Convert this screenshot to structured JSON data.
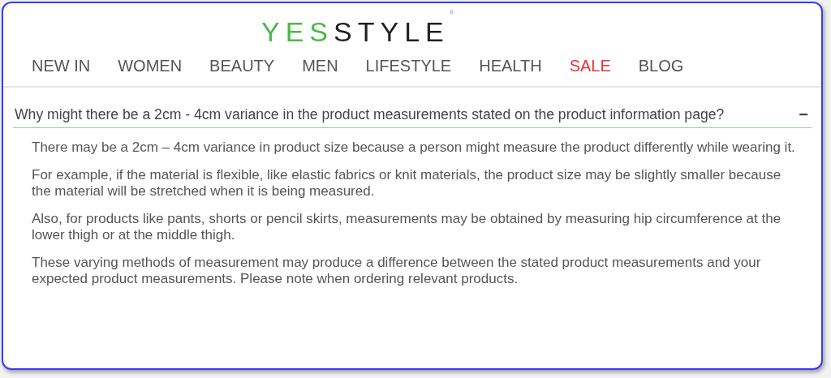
{
  "logo": {
    "parts": [
      {
        "text": "YES",
        "color": "#4cb748"
      },
      {
        "text": "STYLE",
        "color": "#231f20"
      }
    ],
    "mark": "®"
  },
  "nav": [
    {
      "label": "NEW IN",
      "highlighted": false
    },
    {
      "label": "WOMEN",
      "highlighted": false
    },
    {
      "label": "BEAUTY",
      "highlighted": false
    },
    {
      "label": "MEN",
      "highlighted": false
    },
    {
      "label": "LIFESTYLE",
      "highlighted": false
    },
    {
      "label": "HEALTH",
      "highlighted": false
    },
    {
      "label": "SALE",
      "highlighted": true
    },
    {
      "label": "BLOG",
      "highlighted": false
    }
  ],
  "faq": {
    "question": "Why might there be a 2cm - 4cm variance in the product measurements stated on the product information page?",
    "toggle": "−",
    "expanded": true,
    "answer": [
      "There may be a 2cm – 4cm variance in product size because a person might measure the product differently while wearing it.",
      "For example, if the material is flexible, like elastic fabrics or knit materials, the product size may be slightly smaller because the material will be stretched when it is being measured.",
      "Also, for products like pants, shorts or pencil skirts, measurements may be obtained by measuring hip circumference at the lower thigh or at the middle thigh.",
      "These varying methods of measurement may produce a difference between the stated product measurements and your expected product measurements. Please note when ordering relevant products."
    ]
  }
}
